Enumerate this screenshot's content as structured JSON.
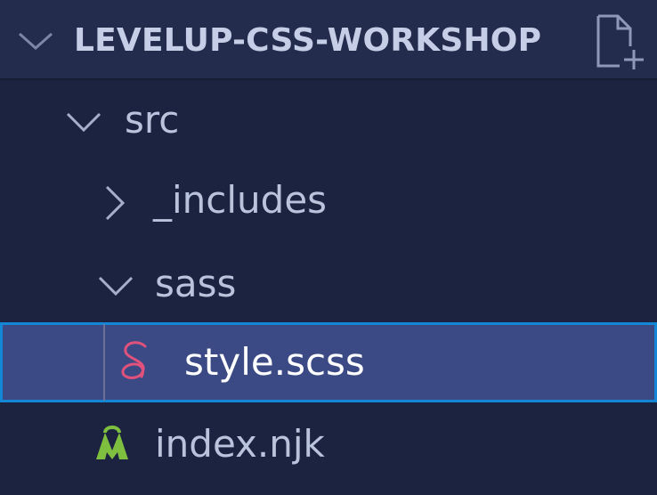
{
  "explorer": {
    "folder_title": "LEVELUP-CSS-WORKSHOP",
    "new_file_icon": "new-file-icon",
    "chevron_open_icon": "chevron-down-icon"
  },
  "tree": {
    "src": {
      "label": "src",
      "icon": "chevron-down-icon"
    },
    "includes": {
      "label": "_includes",
      "icon": "chevron-right-icon"
    },
    "sass": {
      "label": "sass",
      "icon": "chevron-down-icon"
    },
    "style": {
      "label": "style.scss",
      "icon": "sass-file-icon",
      "icon_color": "#e0527c",
      "selected": true
    },
    "index": {
      "label": "index.njk",
      "icon": "nunjucks-file-icon",
      "icon_color": "#7fbf3f"
    }
  },
  "colors": {
    "background": "#1c2340",
    "header_background": "#232c4d",
    "selection_background": "#3b4a85",
    "selection_border": "#1486d6",
    "text": "#bac3dc"
  }
}
